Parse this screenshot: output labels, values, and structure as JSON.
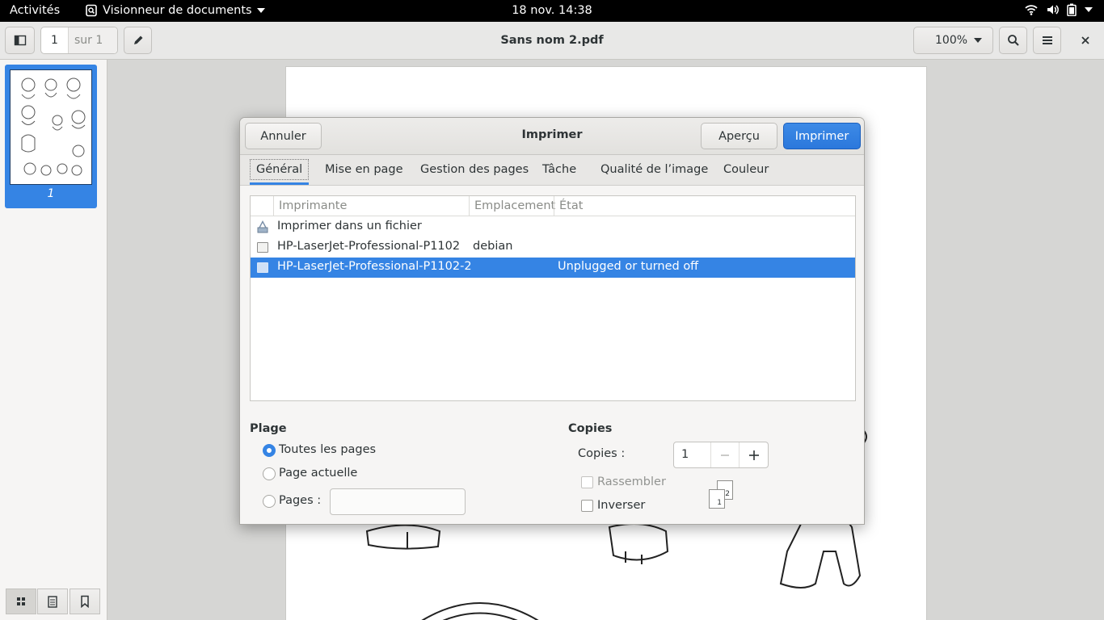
{
  "topbar": {
    "activities": "Activités",
    "app_menu": "Visionneur de documents",
    "clock": "18 nov.  14:38"
  },
  "header": {
    "page_number": "1",
    "page_of": "sur 1",
    "title": "Sans nom 2.pdf",
    "zoom": "100%"
  },
  "sidebar": {
    "thumbnail_label": "1"
  },
  "dialog": {
    "title": "Imprimer",
    "cancel_label": "Annuler",
    "preview_label": "Aperçu",
    "print_label": "Imprimer",
    "tabs": [
      "Général",
      "Mise en page",
      "Gestion des pages",
      "Tâche",
      "Qualité de l’image",
      "Couleur"
    ],
    "printer_table": {
      "columns": [
        "Imprimante",
        "Emplacement",
        "État"
      ],
      "rows": [
        {
          "name": "Imprimer dans un fichier",
          "location": "",
          "state": ""
        },
        {
          "name": "HP-LaserJet-Professional-P1102",
          "location": "debian",
          "state": ""
        },
        {
          "name": "HP-LaserJet-Professional-P1102-2",
          "location": "",
          "state": "Unplugged or turned off",
          "selected": true
        }
      ]
    },
    "range": {
      "heading": "Plage",
      "all_pages": "Toutes les pages",
      "current_page": "Page actuelle",
      "pages": "Pages :",
      "pages_value": "",
      "selected": "all_pages"
    },
    "copies": {
      "heading": "Copies",
      "label": "Copies :",
      "value": "1",
      "collate": "Rassembler",
      "collate_checked": false,
      "collate_enabled": false,
      "reverse": "Inverser",
      "reverse_checked": false,
      "preview_pages": [
        "1",
        "2"
      ]
    }
  },
  "colors": {
    "accent": "#3584e4",
    "topbar_bg": "#000000",
    "panel_bg": "#f6f5f4"
  }
}
